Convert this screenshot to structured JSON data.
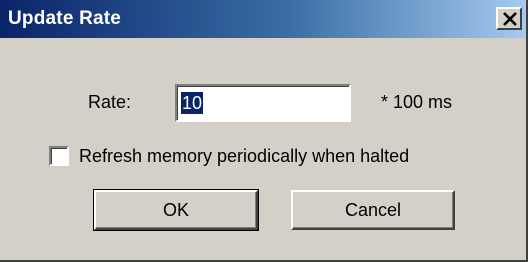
{
  "window": {
    "title": "Update Rate",
    "close_icon": "close-icon"
  },
  "rate": {
    "label": "Rate:",
    "value": "10",
    "unit": "* 100 ms"
  },
  "refresh_option": {
    "label": "Refresh memory periodically when halted",
    "checked": false
  },
  "buttons": {
    "ok": "OK",
    "cancel": "Cancel"
  },
  "colors": {
    "titlebar_start": "#0a246a",
    "titlebar_end": "#a6caf0",
    "face": "#d4d0c8",
    "selection": "#0a246a"
  }
}
